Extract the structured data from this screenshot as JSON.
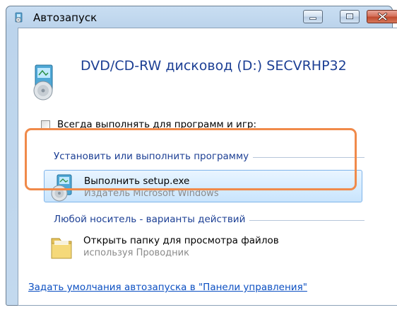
{
  "window": {
    "title": "Автозапуск",
    "controls": {
      "minimize": "minimize",
      "maximize": "maximize",
      "close": "close"
    }
  },
  "device": {
    "title": "DVD/CD-RW дисковод (D:) SECVRHP32",
    "icon": "dvd-drive-icon"
  },
  "always_checkbox": {
    "label": "Всегда выполнять для программ и игр:",
    "checked": false
  },
  "sections": [
    {
      "header": "Установить или выполнить программу",
      "items": [
        {
          "title": "Выполнить setup.exe",
          "subtitle": "Издатель Microsoft Windows",
          "icon": "setup-disc-icon",
          "selected": true
        }
      ]
    },
    {
      "header": "Любой носитель - варианты действий",
      "items": [
        {
          "title": "Открыть папку для просмотра файлов",
          "subtitle": "используя Проводник",
          "icon": "folder-icon",
          "selected": false
        }
      ]
    }
  ],
  "footer_link": "Задать умолчания автозапуска в \"Панели управления\"",
  "colors": {
    "accent_text": "#1c3f94",
    "highlight": "#f08a4a",
    "link": "#0b4fc2"
  }
}
